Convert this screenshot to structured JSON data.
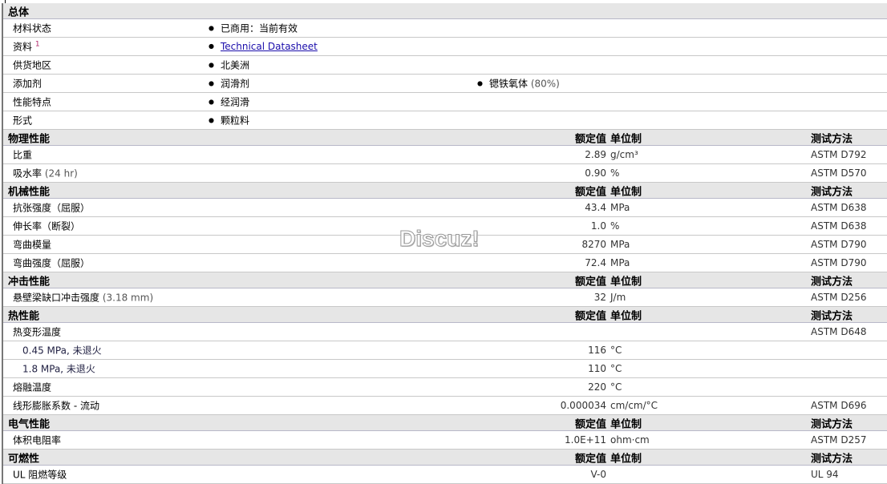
{
  "general": {
    "title": "总体",
    "rows": [
      {
        "label": "材料状态",
        "value": "已商用：当前有效"
      },
      {
        "label": "资料",
        "sup": "1",
        "link": "Technical Datasheet"
      },
      {
        "label": "供货地区",
        "value": "北美洲"
      },
      {
        "label": "添加剂",
        "value": "润滑剂",
        "value2": "锶铁氧体",
        "value2_note": "(80%)"
      },
      {
        "label": "性能特点",
        "value": "经润滑"
      },
      {
        "label": "形式",
        "value": "颗粒料"
      }
    ]
  },
  "col": {
    "value": "额定值",
    "unit": "单位制",
    "test": "测试方法"
  },
  "sections": [
    {
      "title": "物理性能",
      "rows": [
        {
          "label": "比重",
          "value": "2.89",
          "unit": "g/cm³",
          "test": "ASTM D792"
        },
        {
          "label": "吸水率",
          "note": "(24 hr)",
          "value": "0.90",
          "unit": "%",
          "test": "ASTM D570"
        }
      ]
    },
    {
      "title": "机械性能",
      "rows": [
        {
          "label": "抗张强度（屈服）",
          "value": "43.4",
          "unit": "MPa",
          "test": "ASTM D638"
        },
        {
          "label": "伸长率（断裂）",
          "value": "1.0",
          "unit": "%",
          "test": "ASTM D638"
        },
        {
          "label": "弯曲模量",
          "value": "8270",
          "unit": "MPa",
          "test": "ASTM D790"
        },
        {
          "label": "弯曲强度（屈服）",
          "value": "72.4",
          "unit": "MPa",
          "test": "ASTM D790"
        }
      ]
    },
    {
      "title": "冲击性能",
      "rows": [
        {
          "label": "悬壁梁缺口冲击强度",
          "note": "(3.18 mm)",
          "value": "32",
          "unit": "J/m",
          "test": "ASTM D256"
        }
      ]
    },
    {
      "title": "热性能",
      "rows": [
        {
          "label": "热变形温度",
          "test": "ASTM D648"
        },
        {
          "label": "0.45 MPa, 未退火",
          "sub": true,
          "value": "116",
          "unit": "°C"
        },
        {
          "label": "1.8 MPa, 未退火",
          "sub": true,
          "value": "110",
          "unit": "°C"
        },
        {
          "label": "熔融温度",
          "value": "220",
          "unit": "°C"
        },
        {
          "label": "线形膨胀系数 - 流动",
          "value": "0.000034",
          "unit": "cm/cm/°C",
          "test": "ASTM D696"
        }
      ]
    },
    {
      "title": "电气性能",
      "rows": [
        {
          "label": "体积电阻率",
          "value": "1.0E+11",
          "unit": "ohm·cm",
          "test": "ASTM D257"
        }
      ]
    },
    {
      "title": "可燃性",
      "rows": [
        {
          "label": "UL 阻燃等级",
          "value": "V-0",
          "test": "UL 94"
        }
      ]
    }
  ],
  "watermark": "Discuz!"
}
